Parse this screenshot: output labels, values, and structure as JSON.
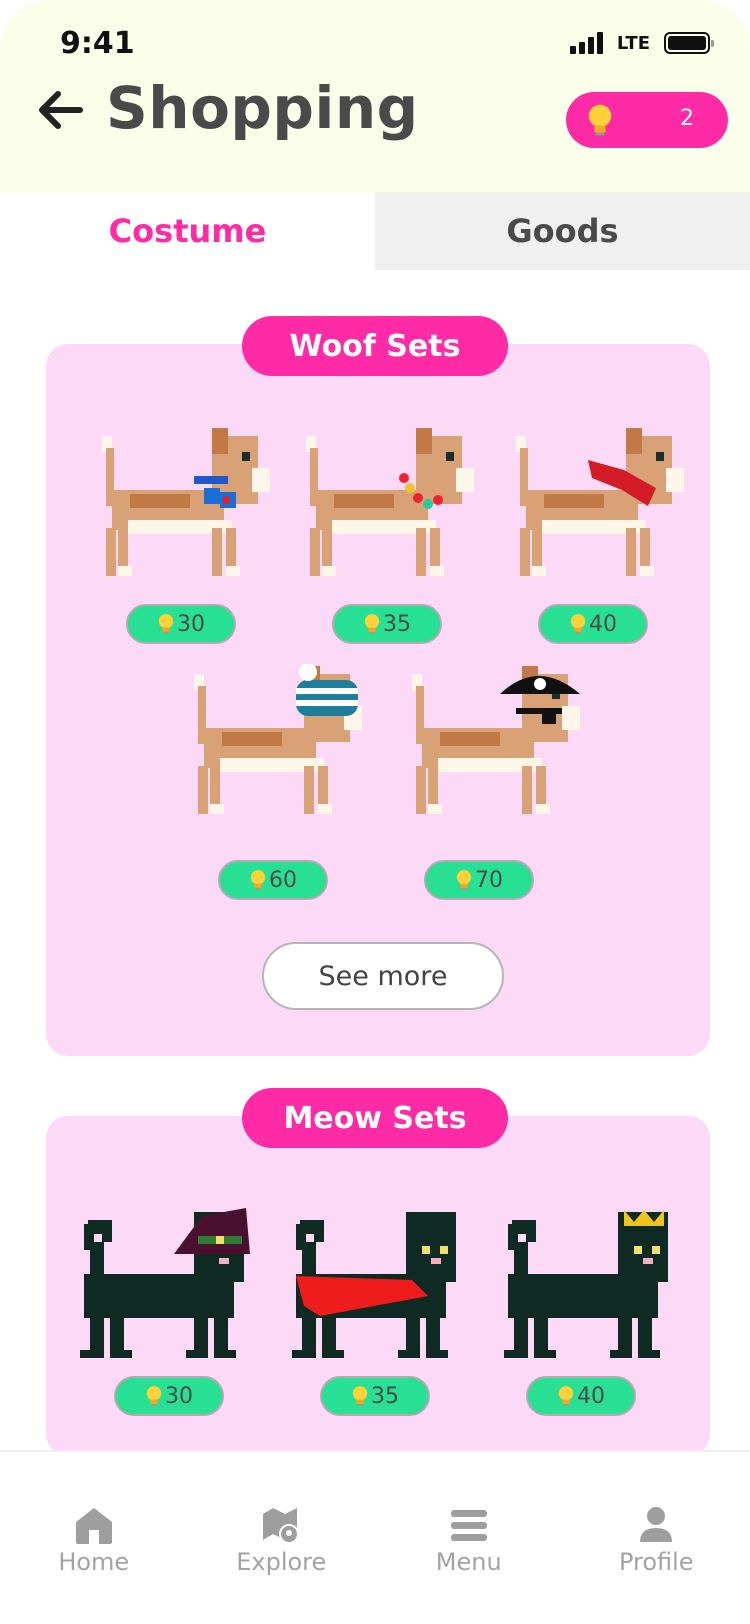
{
  "status_bar": {
    "time": "9:41",
    "network": "LTE"
  },
  "header": {
    "title": "Shopping",
    "points": "2"
  },
  "tabs": [
    {
      "label": "Costume",
      "active": true
    },
    {
      "label": "Goods",
      "active": false
    }
  ],
  "woof_sets": {
    "title": "Woof Sets",
    "items": [
      {
        "costume": "blue-bow-tie",
        "price": "30"
      },
      {
        "costume": "flower-collar",
        "price": "35"
      },
      {
        "costume": "red-scarf",
        "price": "40"
      },
      {
        "costume": "beanie-hat",
        "price": "60"
      },
      {
        "costume": "pirate-hat",
        "price": "70"
      }
    ],
    "see_more": "See more"
  },
  "meow_sets": {
    "title": "Meow Sets",
    "items": [
      {
        "costume": "witch-hat",
        "price": "30"
      },
      {
        "costume": "red-cape",
        "price": "35"
      },
      {
        "costume": "crown",
        "price": "40"
      }
    ]
  },
  "bottom_nav": [
    {
      "label": "Home",
      "icon": "home-icon"
    },
    {
      "label": "Explore",
      "icon": "map-icon"
    },
    {
      "label": "Menu",
      "icon": "menu-icon"
    },
    {
      "label": "Profile",
      "icon": "profile-icon"
    }
  ],
  "colors": {
    "accent": "#ff2aa6",
    "card": "#fcd9f7",
    "price": "#27e094",
    "header_bg": "#fbffe9"
  }
}
